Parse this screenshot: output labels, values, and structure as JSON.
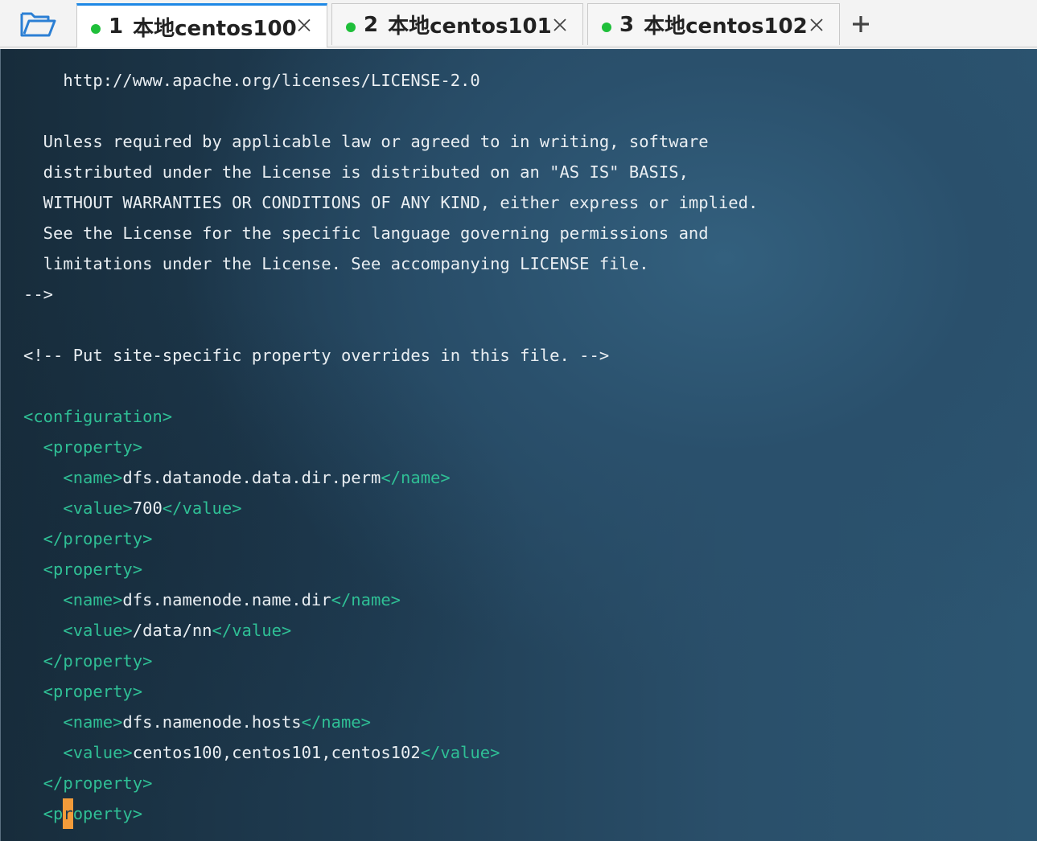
{
  "toolbar": {
    "open_folder_icon": "folder-open-icon",
    "add_tab_icon": "plus-icon"
  },
  "tabs": [
    {
      "num": "1",
      "label": "本地centos100",
      "active": true,
      "status_color": "#1fbf3a"
    },
    {
      "num": "2",
      "label": "本地centos101",
      "active": false,
      "status_color": "#1fbf3a"
    },
    {
      "num": "3",
      "label": "本地centos102",
      "active": false,
      "status_color": "#1fbf3a"
    }
  ],
  "terminal": {
    "colors": {
      "text": "#e9eef2",
      "tag": "#2fbf95",
      "cursor": "#f29b3a"
    },
    "lines": [
      {
        "segments": [
          {
            "t": "text",
            "v": "    http://www.apache.org/licenses/LICENSE-2.0"
          }
        ]
      },
      {
        "segments": [
          {
            "t": "text",
            "v": "  Unless required by applicable law or agreed to in writing, software"
          }
        ]
      },
      {
        "segments": [
          {
            "t": "text",
            "v": "  distributed under the License is distributed on an \"AS IS\" BASIS,"
          }
        ]
      },
      {
        "segments": [
          {
            "t": "text",
            "v": "  WITHOUT WARRANTIES OR CONDITIONS OF ANY KIND, either express or implied."
          }
        ]
      },
      {
        "segments": [
          {
            "t": "text",
            "v": "  See the License for the specific language governing permissions and"
          }
        ]
      },
      {
        "segments": [
          {
            "t": "text",
            "v": "  limitations under the License. See accompanying LICENSE file."
          }
        ]
      },
      {
        "segments": [
          {
            "t": "text",
            "v": "-->"
          }
        ]
      },
      {
        "segments": [
          {
            "t": "text",
            "v": "<!-- Put site-specific property overrides in this file. -->"
          }
        ]
      },
      {
        "segments": [
          {
            "t": "tag",
            "v": "<configuration>"
          }
        ]
      },
      {
        "segments": [
          {
            "t": "tag",
            "v": "  <property>"
          }
        ]
      },
      {
        "segments": [
          {
            "t": "tag",
            "v": "    <name>"
          },
          {
            "t": "text",
            "v": "dfs.datanode.data.dir.perm"
          },
          {
            "t": "tag",
            "v": "</name>"
          }
        ]
      },
      {
        "segments": [
          {
            "t": "tag",
            "v": "    <value>"
          },
          {
            "t": "text",
            "v": "700"
          },
          {
            "t": "tag",
            "v": "</value>"
          }
        ]
      },
      {
        "segments": [
          {
            "t": "tag",
            "v": "  </property>"
          }
        ]
      },
      {
        "segments": [
          {
            "t": "tag",
            "v": "  <property>"
          }
        ]
      },
      {
        "segments": [
          {
            "t": "tag",
            "v": "    <name>"
          },
          {
            "t": "text",
            "v": "dfs.namenode.name.dir"
          },
          {
            "t": "tag",
            "v": "</name>"
          }
        ]
      },
      {
        "segments": [
          {
            "t": "tag",
            "v": "    <value>"
          },
          {
            "t": "text",
            "v": "/data/nn"
          },
          {
            "t": "tag",
            "v": "</value>"
          }
        ]
      },
      {
        "segments": [
          {
            "t": "tag",
            "v": "  </property>"
          }
        ]
      },
      {
        "segments": [
          {
            "t": "tag",
            "v": "  <property>"
          }
        ]
      },
      {
        "segments": [
          {
            "t": "tag",
            "v": "    <name>"
          },
          {
            "t": "text",
            "v": "dfs.namenode.hosts"
          },
          {
            "t": "tag",
            "v": "</name>"
          }
        ]
      },
      {
        "segments": [
          {
            "t": "tag",
            "v": "    <value>"
          },
          {
            "t": "text",
            "v": "centos100,centos101,centos102"
          },
          {
            "t": "tag",
            "v": "</value>"
          }
        ]
      },
      {
        "segments": [
          {
            "t": "tag",
            "v": "  </property>"
          }
        ]
      },
      {
        "segments": [
          {
            "t": "tag",
            "v": "  <p"
          },
          {
            "t": "cursor",
            "v": "r"
          },
          {
            "t": "tag",
            "v": "operty>"
          }
        ]
      }
    ]
  }
}
